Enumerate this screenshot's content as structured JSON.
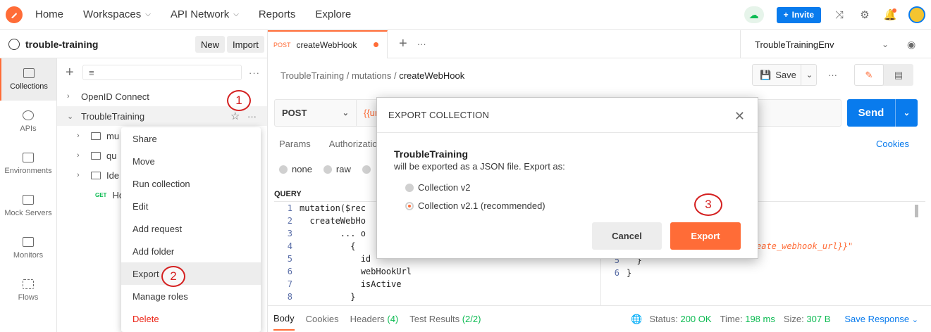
{
  "topbar": {
    "nav": [
      {
        "label": "Home",
        "has_menu": false
      },
      {
        "label": "Workspaces",
        "has_menu": true
      },
      {
        "label": "API Network",
        "has_menu": true
      },
      {
        "label": "Reports",
        "has_menu": false
      },
      {
        "label": "Explore",
        "has_menu": false
      }
    ],
    "invite_label": "Invite",
    "icons": [
      "sync-cloud-icon",
      "satellite-icon",
      "gear-icon",
      "bell-icon",
      "avatar"
    ]
  },
  "workspace": {
    "name": "trouble-training",
    "new_label": "New",
    "import_label": "Import"
  },
  "rail": [
    {
      "label": "Collections",
      "icon": "collections-icon",
      "active": true
    },
    {
      "label": "APIs",
      "icon": "apis-icon",
      "active": false
    },
    {
      "label": "Environments",
      "icon": "environments-icon",
      "active": false
    },
    {
      "label": "Mock Servers",
      "icon": "mock-servers-icon",
      "active": false
    },
    {
      "label": "Monitors",
      "icon": "monitors-icon",
      "active": false
    },
    {
      "label": "Flows",
      "icon": "flows-icon",
      "active": false
    }
  ],
  "tree": {
    "collection1": "OpenID Connect",
    "collection2": "TroubleTraining",
    "folder1": "mu",
    "folder2": "qu",
    "folder3": "Ide",
    "request_method": "GET",
    "request_name": "Ho"
  },
  "context_menu": {
    "items": [
      "Share",
      "Move",
      "Run collection",
      "Edit",
      "Add request",
      "Add folder",
      "Export",
      "Manage roles",
      "Delete"
    ]
  },
  "annotations": {
    "a1": "1",
    "a2": "2",
    "a3": "3"
  },
  "tabs": {
    "method": "POST",
    "name": "createWebHook",
    "environment": "TroubleTrainingEnv"
  },
  "breadcrumb": {
    "part1": "TroubleTraining",
    "sep": "/",
    "part2": "mutations",
    "current": "createWebHook"
  },
  "save_label": "Save",
  "request": {
    "method": "POST",
    "url_partial": "{{ur",
    "send_label": "Send"
  },
  "request_tabs": [
    "Params",
    "Authorization"
  ],
  "cookies_label": "Cookies",
  "body_modes": [
    "none",
    "raw"
  ],
  "query_label": "QUERY",
  "query_lines": [
    {
      "n": "1",
      "text": "mutation($rec"
    },
    {
      "n": "2",
      "text": "  createWebHo"
    },
    {
      "n": "3",
      "text": "        ... o"
    },
    {
      "n": "4",
      "text": "          {"
    },
    {
      "n": "5",
      "text": "            id"
    },
    {
      "n": "6",
      "text": "            webHookUrl"
    },
    {
      "n": "7",
      "text": "            isActive"
    },
    {
      "n": "8",
      "text": "          }"
    }
  ],
  "vars_lines": [
    {
      "n": "5",
      "text": "  }"
    },
    {
      "n": "6",
      "text": "}"
    }
  ],
  "vars_fragment": "eate_webhook_url}}\"",
  "response_bar": {
    "tabs": [
      {
        "label": "Body",
        "count": ""
      },
      {
        "label": "Cookies",
        "count": ""
      },
      {
        "label": "Headers",
        "count": "(4)"
      },
      {
        "label": "Test Results",
        "count": "(2/2)"
      }
    ],
    "status_label": "Status:",
    "status_value": "200 OK",
    "time_label": "Time:",
    "time_value": "198 ms",
    "size_label": "Size:",
    "size_value": "307 B",
    "save_response": "Save Response"
  },
  "modal": {
    "title": "EXPORT COLLECTION",
    "collection": "TroubleTraining",
    "description": "will be exported as a JSON file. Export as:",
    "option1": "Collection v2",
    "option2": "Collection v2.1 (recommended)",
    "selected": "Collection v2.1 (recommended)",
    "cancel_label": "Cancel",
    "export_label": "Export"
  },
  "colors": {
    "brand": "#ff6c37",
    "primary_blue": "#097bed",
    "success_green": "#0cbb52",
    "annotation_red": "#d42020"
  }
}
